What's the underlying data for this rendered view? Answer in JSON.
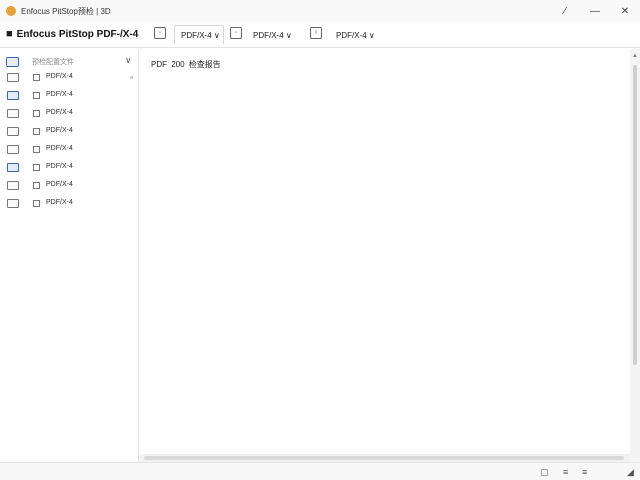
{
  "window": {
    "title": "Enfocus PitStop预检 | 3D",
    "controls": {
      "pin": "⁄",
      "minimize": "—",
      "close": "✕"
    }
  },
  "toolbar": {
    "document_title": "Enfocus PitStop PDF-/X-4",
    "tabs": [
      {
        "label": "PDF/X-4 ∨"
      },
      {
        "label": "PDF/X-4 ∨"
      },
      {
        "label": "PDF/X-4 ∨"
      }
    ]
  },
  "sidebar": {
    "header_label": "预检配置文件",
    "items": [
      {
        "label": "PDF/X-4"
      },
      {
        "label": "PDF/X-4"
      },
      {
        "label": "PDF/X-4"
      },
      {
        "label": "PDF/X-4"
      },
      {
        "label": "PDF/X-4"
      },
      {
        "label": "PDF/X-4"
      },
      {
        "label": "PDF/X-4"
      },
      {
        "label": "PDF/X-4"
      }
    ]
  },
  "main": {
    "line": "PDF 200 检查报告"
  }
}
